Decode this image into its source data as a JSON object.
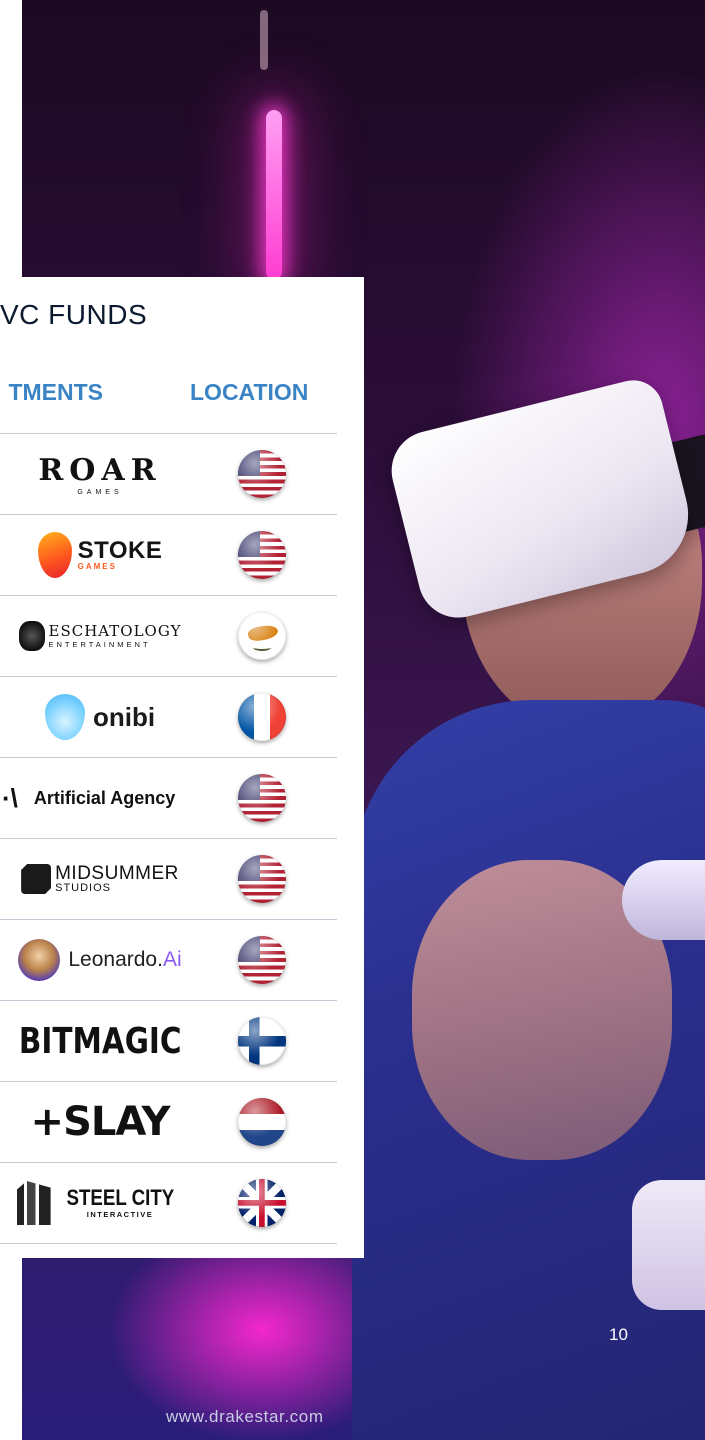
{
  "panel": {
    "title": "VC FUNDS",
    "columns": {
      "investments": "TMENTS",
      "location": "LOCATION"
    }
  },
  "rows": [
    {
      "company": "ROAR",
      "company_sub": "GAMES",
      "flag": "flag-usa",
      "flag_colors": [
        "#b22234",
        "#ffffff",
        "#3c3b6e"
      ]
    },
    {
      "company": "STOKE",
      "company_sub": "GAMES",
      "flag": "flag-usa",
      "flag_colors": [
        "#b22234",
        "#ffffff",
        "#3c3b6e"
      ]
    },
    {
      "company": "ESCHATOLOGY",
      "company_sub": "ENTERTAINMENT",
      "flag": "flag-cyprus",
      "flag_colors": [
        "#ffffff",
        "#d57800",
        "#4e5b31"
      ]
    },
    {
      "company": "onibi",
      "flag": "flag-france",
      "flag_colors": [
        "#0055a4",
        "#ffffff",
        "#ef4135"
      ]
    },
    {
      "company": "Artificial Agency",
      "company_mark": "·\\",
      "flag": "flag-usa",
      "flag_colors": [
        "#b22234",
        "#ffffff",
        "#3c3b6e"
      ]
    },
    {
      "company": "MIDSUMMER",
      "company_sub": "STUDIOS",
      "flag": "flag-usa",
      "flag_colors": [
        "#b22234",
        "#ffffff",
        "#3c3b6e"
      ]
    },
    {
      "company": "Leonardo.",
      "company_accent": "Ai",
      "flag": "flag-usa",
      "flag_colors": [
        "#b22234",
        "#ffffff",
        "#3c3b6e"
      ]
    },
    {
      "company": "BITMAGIC",
      "flag": "flag-finland",
      "flag_colors": [
        "#ffffff",
        "#003580"
      ]
    },
    {
      "company": "+SLAY",
      "flag": "flag-netherlands",
      "flag_colors": [
        "#ae1c28",
        "#ffffff",
        "#21468b"
      ]
    },
    {
      "company": "STEEL CITY",
      "company_sub": "INTERACTIVE",
      "flag": "flag-united-kingdom",
      "flag_colors": [
        "#012169",
        "#ffffff",
        "#c8102e"
      ]
    }
  ],
  "footer": {
    "page_number": "10",
    "website": "www.drakestar.com"
  },
  "colors": {
    "accent": "#3a84c6",
    "title": "#0b1a2e",
    "divider": "#c4ccd8"
  }
}
